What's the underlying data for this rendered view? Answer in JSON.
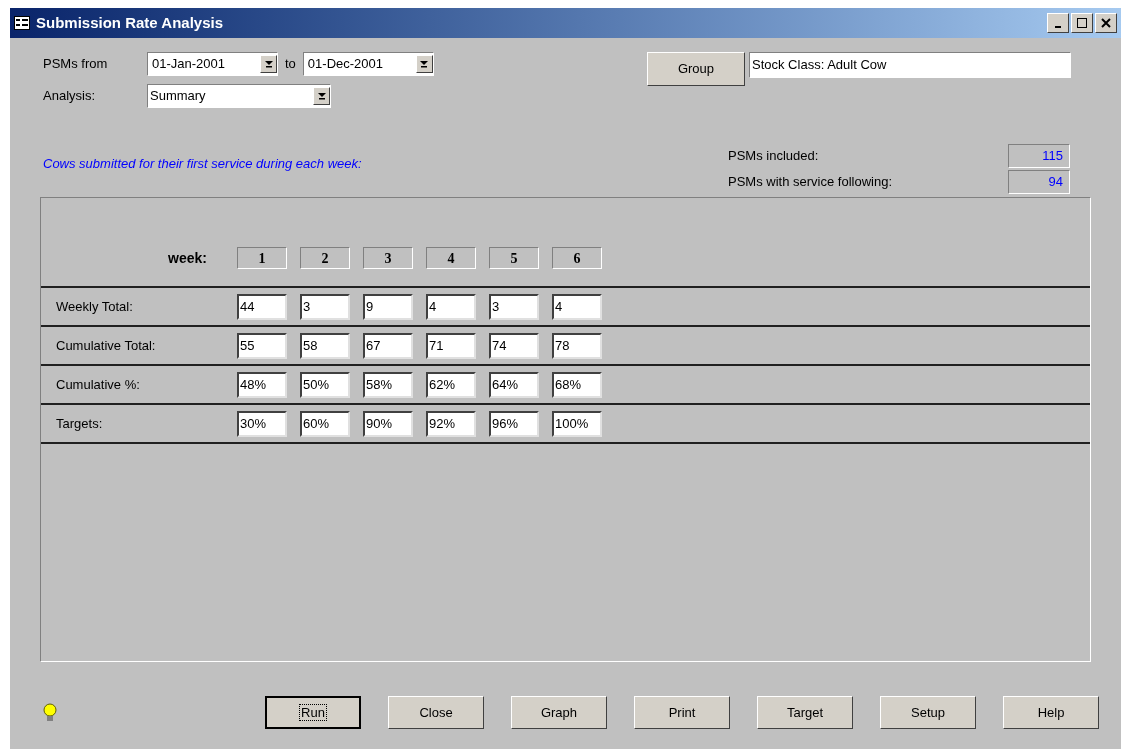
{
  "window": {
    "title": "Submission Rate Analysis"
  },
  "filters": {
    "from_label": "PSMs from",
    "from_value": "01-Jan-2001",
    "to_label": "to",
    "to_value": "01-Dec-2001",
    "analysis_label": "Analysis:",
    "analysis_value": "Summary"
  },
  "group": {
    "button": "Group",
    "value": "Stock Class: Adult Cow"
  },
  "caption": "Cows submitted for their first service during each week:",
  "stats": [
    {
      "label": "PSMs included:",
      "value": "115"
    },
    {
      "label": "PSMs with service following:",
      "value": "94"
    }
  ],
  "table": {
    "header_label": "week:",
    "weeks": [
      "1",
      "2",
      "3",
      "4",
      "5",
      "6"
    ],
    "rows": [
      {
        "label": "Weekly Total:",
        "cells": [
          "44",
          "3",
          "9",
          "4",
          "3",
          "4"
        ]
      },
      {
        "label": "Cumulative Total:",
        "cells": [
          "55",
          "58",
          "67",
          "71",
          "74",
          "78"
        ]
      },
      {
        "label": "Cumulative %:",
        "cells": [
          "48%",
          "50%",
          "58%",
          "62%",
          "64%",
          "68%"
        ]
      },
      {
        "label": "Targets:",
        "cells": [
          "30%",
          "60%",
          "90%",
          "92%",
          "96%",
          "100%"
        ]
      }
    ]
  },
  "buttons": [
    {
      "label": "Run",
      "default": true
    },
    {
      "label": "Close",
      "default": false
    },
    {
      "label": "Graph",
      "default": false
    },
    {
      "label": "Print",
      "default": false
    },
    {
      "label": "Target",
      "default": false
    },
    {
      "label": "Setup",
      "default": false
    },
    {
      "label": "Help",
      "default": false
    }
  ]
}
